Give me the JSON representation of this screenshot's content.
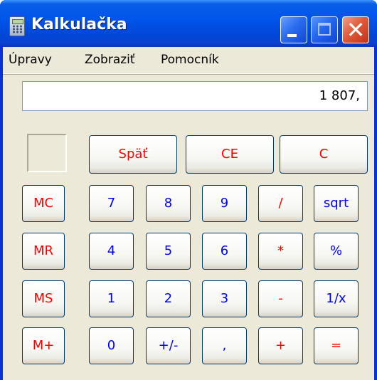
{
  "window": {
    "title": "Kalkulačka",
    "icon": "calculator-icon",
    "controls": {
      "minimize_icon": "minimize-icon",
      "maximize_icon": "maximize-icon",
      "close_icon": "close-icon",
      "close_glyph": "✕"
    }
  },
  "menu": {
    "items": [
      "Úpravy",
      "Zobraziť",
      "Pomocník"
    ]
  },
  "display": {
    "value": "1 807,"
  },
  "keys": {
    "top_row": [
      "Späť",
      "CE",
      "C"
    ],
    "memory": [
      "MC",
      "MR",
      "MS",
      "M+"
    ],
    "rows": [
      [
        "7",
        "8",
        "9",
        "/",
        "sqrt"
      ],
      [
        "4",
        "5",
        "6",
        "*",
        "%"
      ],
      [
        "1",
        "2",
        "3",
        "-",
        "1/x"
      ],
      [
        "0",
        "+/-",
        ",",
        "+",
        "="
      ]
    ]
  },
  "colors": {
    "titlebar": "#0055ea",
    "client_background": "#ece9d8",
    "digit_text": "#0000ff",
    "operator_text": "#ff0000",
    "key_border": "#003c74"
  }
}
